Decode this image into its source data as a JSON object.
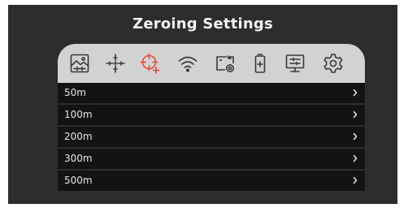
{
  "screen": {
    "title": "Zeroing Settings"
  },
  "toolbar": {
    "items": [
      {
        "icon": "image-settings-icon",
        "active": false
      },
      {
        "icon": "crosshair-reticle-icon",
        "active": false
      },
      {
        "icon": "zeroing-target-icon",
        "active": true
      },
      {
        "icon": "wifi-icon",
        "active": false
      },
      {
        "icon": "camera-record-icon",
        "active": false
      },
      {
        "icon": "battery-icon",
        "active": false
      },
      {
        "icon": "display-settings-icon",
        "active": false
      },
      {
        "icon": "gear-icon",
        "active": false
      }
    ],
    "active_color": "#e8453c",
    "icon_color": "#3a3a3a"
  },
  "menu": {
    "items": [
      {
        "label": "50m"
      },
      {
        "label": "100m"
      },
      {
        "label": "200m"
      },
      {
        "label": "300m"
      },
      {
        "label": "500m"
      }
    ]
  }
}
